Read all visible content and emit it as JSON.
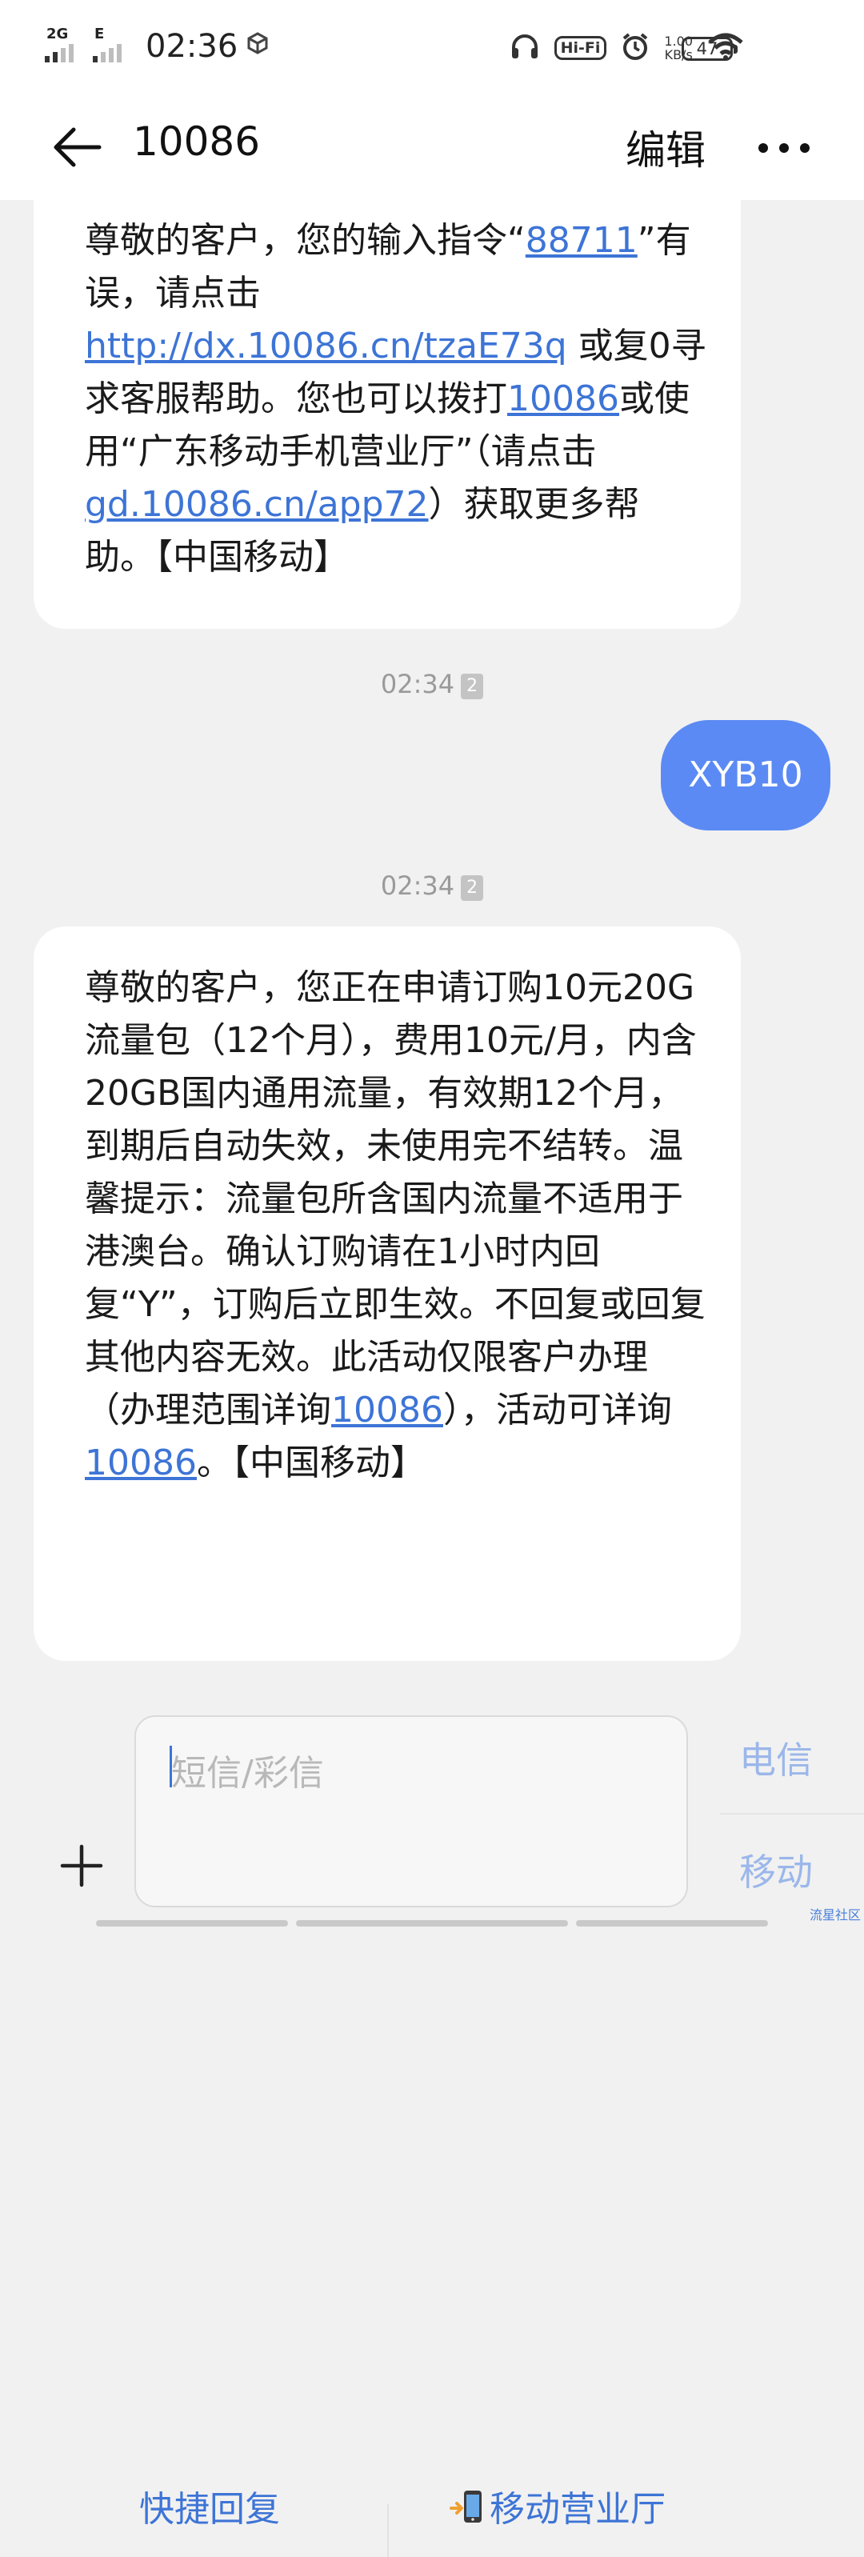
{
  "status_bar": {
    "sim1_network": "2G",
    "sim2_network": "E",
    "time": "02:36",
    "app_indicator_icon": "cube-icon",
    "headphones_icon": "headphones-icon",
    "hifi_label": "Hi-Fi",
    "alarm_icon": "alarm-icon",
    "speed_value": "1.00",
    "speed_unit": "KB/s",
    "wifi_icon": "wifi-icon",
    "battery_level": "47"
  },
  "header": {
    "title": "10086",
    "edit_label": "编辑",
    "back_icon": "arrow-left-icon",
    "more_icon": "more-dots-icon"
  },
  "messages": [
    {
      "type": "incoming",
      "parts": [
        {
          "t": "尊敬的客户，您的输入指令“"
        },
        {
          "link": "88711"
        },
        {
          "t": "”有误，请点击"
        },
        {
          "link": "http://dx.10086.cn/tzaE73q"
        },
        {
          "t": " 或复0寻求客服帮助。您也可以拨打"
        },
        {
          "link": "10086"
        },
        {
          "t": "或使用“广东移动手机营业厅”（请点击 "
        },
        {
          "link": "gd.10086.cn/app72"
        },
        {
          "t": "）获取更多帮助。【中国移动】"
        }
      ]
    },
    {
      "type": "timestamp",
      "time": "02:34",
      "sim": "2"
    },
    {
      "type": "outgoing",
      "text": "XYB10"
    },
    {
      "type": "timestamp",
      "time": "02:34",
      "sim": "2"
    },
    {
      "type": "incoming",
      "parts": [
        {
          "t": "尊敬的客户，您正在申请订购10元20G流量包（12个月），费用10元/月，内含20GB国内通用流量，有效期12个月，到期后自动失效，未使用完不结转。温馨提示：流量包所含国内流量不适用于港澳台。确认订购请在1小时内回复“Y”，订购后立即生效。不回复或回复其他内容无效。此活动仅限客户办理（办理范围详询"
        },
        {
          "link": "10086"
        },
        {
          "t": "），活动可详询"
        },
        {
          "link": "10086"
        },
        {
          "t": "。【中国移动】"
        }
      ],
      "actions": {
        "quick_reply": "快捷回复",
        "mobile_hall": "移动营业厅",
        "mobile_hall_icon": "mobile-phone-icon"
      }
    }
  ],
  "composer": {
    "placeholder": "短信/彩信",
    "send_sim1": "电信",
    "send_sim2": "移动",
    "add_icon": "plus-icon"
  },
  "watermark": "流星社区",
  "colors": {
    "accent": "#3d74d6",
    "outgoing_bubble": "#5b8af4",
    "background": "#f1f1f1"
  }
}
